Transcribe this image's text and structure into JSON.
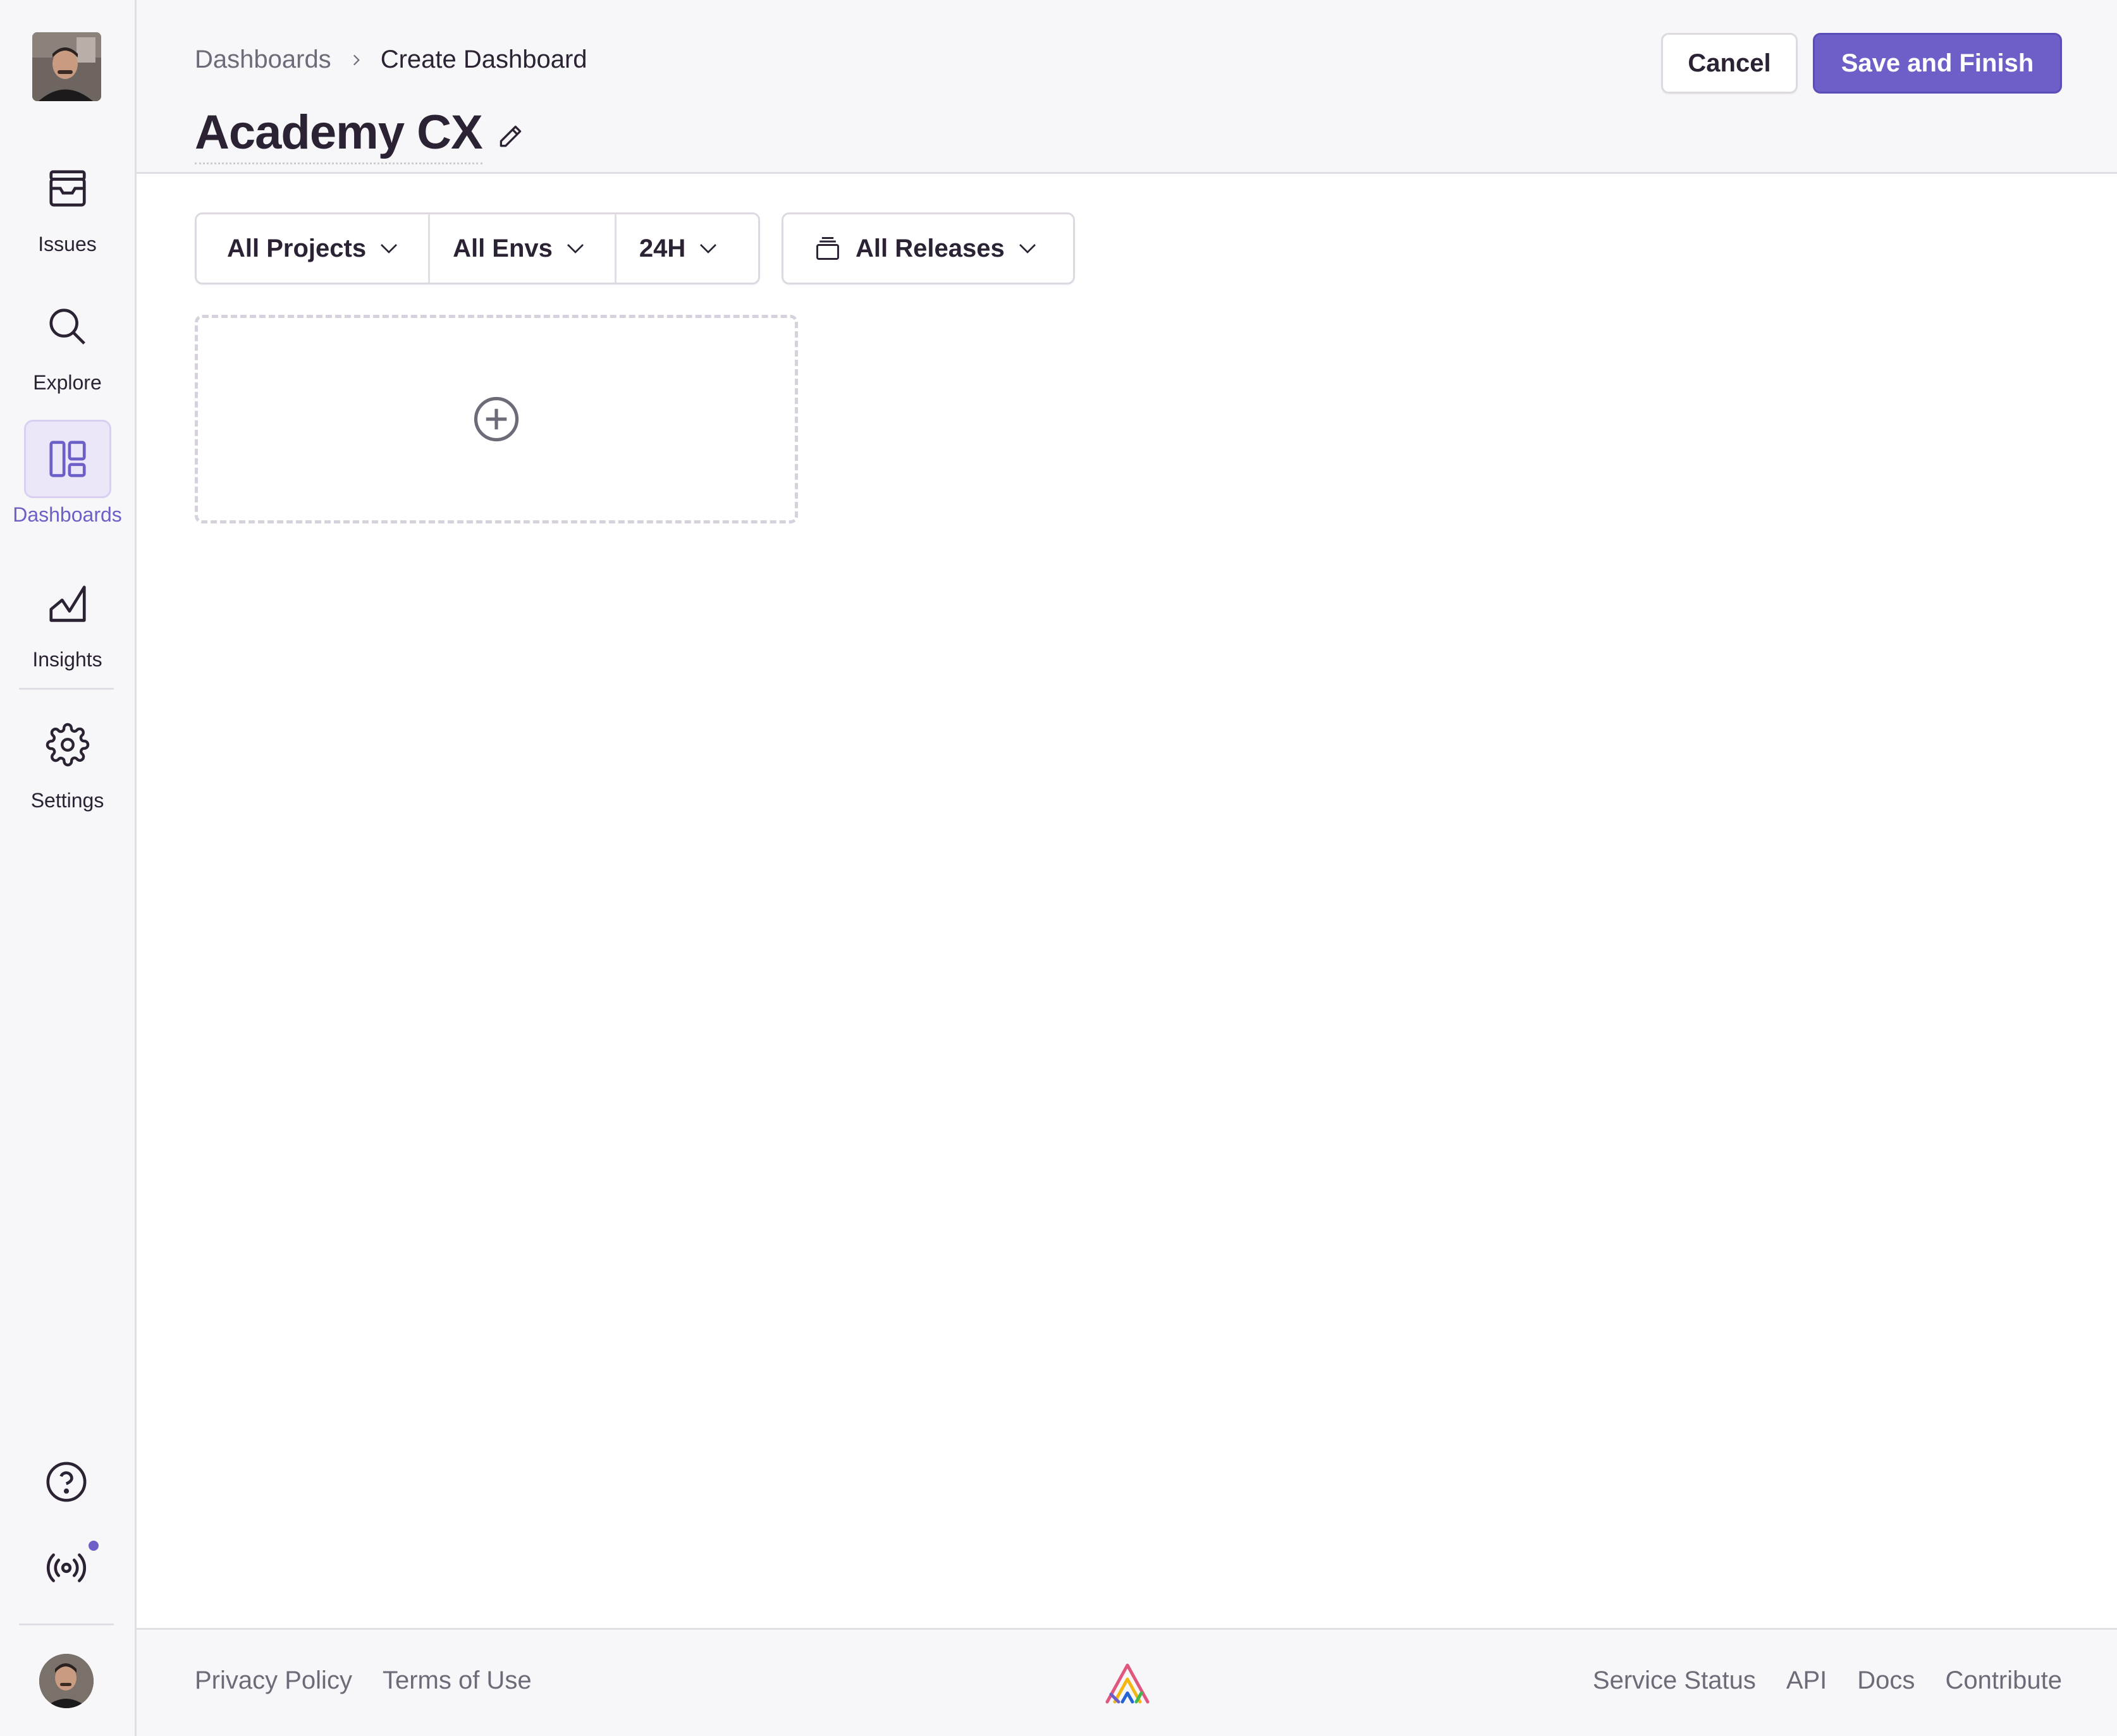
{
  "sidebar": {
    "items": [
      {
        "label": "Issues",
        "icon": "issues-icon"
      },
      {
        "label": "Explore",
        "icon": "search-icon"
      },
      {
        "label": "Dashboards",
        "icon": "dashboards-icon",
        "active": true
      },
      {
        "label": "Insights",
        "icon": "insights-icon"
      },
      {
        "label": "Settings",
        "icon": "gear-icon"
      }
    ],
    "bottom_icons": [
      "help-icon",
      "broadcast-icon"
    ]
  },
  "header": {
    "breadcrumb": {
      "parent": "Dashboards",
      "current": "Create Dashboard"
    },
    "title": "Academy CX",
    "cancel_label": "Cancel",
    "save_label": "Save and Finish"
  },
  "filters": {
    "projects": "All Projects",
    "envs": "All Envs",
    "period": "24H",
    "releases": "All Releases"
  },
  "footer": {
    "left": [
      "Privacy Policy",
      "Terms of Use"
    ],
    "right": [
      "Service Status",
      "API",
      "Docs",
      "Contribute"
    ]
  },
  "colors": {
    "accent": "#6c5fc7",
    "text": "#2b2233",
    "muted": "#6f6a78",
    "border": "#e2dee6",
    "panel": "#f7f7f9"
  }
}
